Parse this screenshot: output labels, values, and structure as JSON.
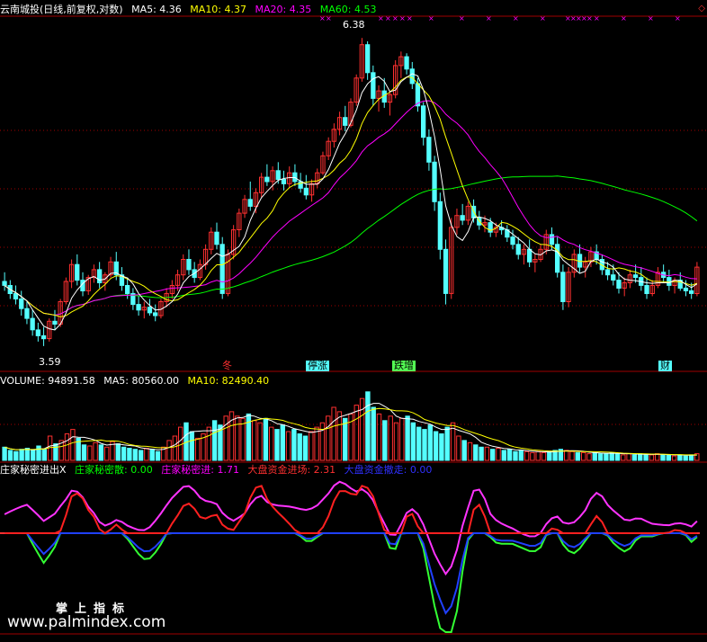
{
  "header": {
    "title": "云南城投(日线,前复权,对数)",
    "ma5": "MA5: 4.36",
    "ma10": "MA10: 4.37",
    "ma20": "MA20: 4.35",
    "ma60": "MA60: 4.53"
  },
  "volume_header": {
    "volume": "VOLUME: 94891.58",
    "ma5": "MA5: 80560.00",
    "ma10": "MA10: 82490.40"
  },
  "indicator_header": {
    "name": "庄家秘密进出X",
    "l1": "庄家秘密散: 0.00",
    "l2": "庄家秘密进: 1.71",
    "l3": "大盘资金进场: 2.31",
    "l4": "大盘资金撤走: 0.00"
  },
  "annotations": {
    "high": "6.38",
    "low": "3.59",
    "tag1": "停涨",
    "tag2": "跌增",
    "tag3": "财",
    "tag0": "冬"
  },
  "watermark": {
    "line1": "掌上指标",
    "line2": "www.palmindex.com"
  },
  "colors": {
    "up": "#ff3030",
    "down": "#54ffff",
    "ma5": "#ffffff",
    "ma10": "#ffff00",
    "ma20": "#ff00ff",
    "ma60": "#00ff00",
    "grid": "#a00000"
  },
  "chart_data": {
    "type": "candlestick",
    "price_scale": "log",
    "ylim": [
      3.5,
      6.6
    ],
    "ohlc": [
      [
        4.05,
        4.12,
        3.98,
        4.02
      ],
      [
        4.02,
        4.06,
        3.92,
        3.96
      ],
      [
        3.96,
        4.02,
        3.88,
        3.92
      ],
      [
        3.92,
        3.98,
        3.8,
        3.85
      ],
      [
        3.85,
        3.9,
        3.74,
        3.78
      ],
      [
        3.78,
        3.84,
        3.66,
        3.7
      ],
      [
        3.7,
        3.75,
        3.62,
        3.66
      ],
      [
        3.66,
        3.72,
        3.59,
        3.64
      ],
      [
        3.64,
        3.78,
        3.62,
        3.76
      ],
      [
        3.76,
        3.84,
        3.7,
        3.74
      ],
      [
        3.74,
        3.92,
        3.72,
        3.9
      ],
      [
        3.9,
        4.08,
        3.88,
        4.05
      ],
      [
        4.05,
        4.22,
        4.0,
        4.18
      ],
      [
        4.18,
        4.26,
        4.02,
        4.06
      ],
      [
        4.06,
        4.12,
        3.94,
        3.98
      ],
      [
        3.98,
        4.1,
        3.95,
        4.08
      ],
      [
        4.08,
        4.18,
        4.04,
        4.14
      ],
      [
        4.14,
        4.2,
        4.0,
        4.04
      ],
      [
        4.04,
        4.12,
        3.98,
        4.1
      ],
      [
        4.1,
        4.24,
        4.08,
        4.2
      ],
      [
        4.2,
        4.28,
        4.06,
        4.1
      ],
      [
        4.1,
        4.16,
        3.98,
        4.02
      ],
      [
        4.02,
        4.08,
        3.92,
        3.96
      ],
      [
        3.96,
        4.0,
        3.84,
        3.88
      ],
      [
        3.88,
        3.94,
        3.8,
        3.84
      ],
      [
        3.84,
        3.9,
        3.78,
        3.86
      ],
      [
        3.86,
        3.92,
        3.8,
        3.82
      ],
      [
        3.82,
        3.88,
        3.76,
        3.8
      ],
      [
        3.8,
        3.92,
        3.78,
        3.9
      ],
      [
        3.9,
        4.0,
        3.86,
        3.96
      ],
      [
        3.96,
        4.06,
        3.92,
        4.02
      ],
      [
        4.02,
        4.14,
        3.98,
        4.1
      ],
      [
        4.1,
        4.26,
        4.06,
        4.22
      ],
      [
        4.22,
        4.3,
        4.1,
        4.14
      ],
      [
        4.14,
        4.2,
        4.04,
        4.08
      ],
      [
        4.08,
        4.22,
        4.06,
        4.18
      ],
      [
        4.18,
        4.34,
        4.14,
        4.3
      ],
      [
        4.3,
        4.48,
        4.26,
        4.44
      ],
      [
        4.44,
        4.52,
        4.3,
        4.34
      ],
      [
        4.34,
        4.4,
        3.92,
        3.96
      ],
      [
        3.96,
        4.3,
        3.94,
        4.26
      ],
      [
        4.26,
        4.5,
        4.22,
        4.46
      ],
      [
        4.46,
        4.64,
        4.4,
        4.6
      ],
      [
        4.6,
        4.76,
        4.56,
        4.72
      ],
      [
        4.72,
        4.88,
        4.62,
        4.66
      ],
      [
        4.66,
        4.82,
        4.6,
        4.78
      ],
      [
        4.78,
        4.96,
        4.74,
        4.92
      ],
      [
        4.92,
        5.04,
        4.84,
        4.88
      ],
      [
        4.88,
        5.02,
        4.8,
        4.98
      ],
      [
        4.98,
        5.06,
        4.86,
        4.9
      ],
      [
        4.9,
        4.98,
        4.8,
        4.86
      ],
      [
        4.86,
        5.02,
        4.82,
        4.96
      ],
      [
        4.96,
        5.04,
        4.84,
        4.88
      ],
      [
        4.88,
        4.96,
        4.78,
        4.82
      ],
      [
        4.82,
        4.94,
        4.72,
        4.76
      ],
      [
        4.76,
        4.9,
        4.7,
        4.86
      ],
      [
        4.86,
        5.0,
        4.82,
        4.96
      ],
      [
        4.96,
        5.16,
        4.94,
        5.12
      ],
      [
        5.12,
        5.3,
        5.08,
        5.26
      ],
      [
        5.26,
        5.44,
        5.2,
        5.38
      ],
      [
        5.38,
        5.56,
        5.32,
        5.5
      ],
      [
        5.5,
        5.62,
        5.36,
        5.42
      ],
      [
        5.42,
        5.7,
        5.4,
        5.66
      ],
      [
        5.66,
        5.96,
        5.62,
        5.92
      ],
      [
        5.92,
        6.38,
        5.88,
        6.3
      ],
      [
        6.3,
        6.34,
        5.9,
        5.98
      ],
      [
        5.98,
        6.06,
        5.62,
        5.7
      ],
      [
        5.7,
        5.84,
        5.56,
        5.78
      ],
      [
        5.78,
        5.92,
        5.6,
        5.66
      ],
      [
        5.66,
        5.78,
        5.52,
        5.74
      ],
      [
        5.74,
        6.12,
        5.7,
        6.06
      ],
      [
        6.06,
        6.22,
        5.92,
        6.16
      ],
      [
        6.16,
        6.2,
        5.96,
        6.02
      ],
      [
        6.02,
        6.1,
        5.8,
        5.86
      ],
      [
        5.86,
        5.92,
        5.56,
        5.62
      ],
      [
        5.62,
        5.66,
        5.22,
        5.3
      ],
      [
        5.3,
        5.38,
        4.98,
        5.06
      ],
      [
        5.06,
        5.12,
        4.62,
        4.7
      ],
      [
        4.7,
        4.78,
        4.22,
        4.3
      ],
      [
        4.3,
        4.38,
        3.88,
        3.96
      ],
      [
        3.96,
        4.56,
        3.92,
        4.48
      ],
      [
        4.48,
        4.64,
        4.42,
        4.58
      ],
      [
        4.58,
        4.68,
        4.5,
        4.54
      ],
      [
        4.54,
        4.7,
        4.5,
        4.66
      ],
      [
        4.66,
        4.72,
        4.52,
        4.56
      ],
      [
        4.56,
        4.62,
        4.46,
        4.5
      ],
      [
        4.5,
        4.58,
        4.44,
        4.52
      ],
      [
        4.52,
        4.56,
        4.4,
        4.44
      ],
      [
        4.44,
        4.52,
        4.4,
        4.48
      ],
      [
        4.48,
        4.54,
        4.42,
        4.46
      ],
      [
        4.46,
        4.5,
        4.36,
        4.4
      ],
      [
        4.4,
        4.46,
        4.3,
        4.34
      ],
      [
        4.34,
        4.4,
        4.22,
        4.26
      ],
      [
        4.26,
        4.34,
        4.18,
        4.3
      ],
      [
        4.3,
        4.38,
        4.16,
        4.2
      ],
      [
        4.2,
        4.26,
        4.12,
        4.22
      ],
      [
        4.22,
        4.34,
        4.2,
        4.3
      ],
      [
        4.3,
        4.46,
        4.26,
        4.42
      ],
      [
        4.42,
        4.48,
        4.3,
        4.34
      ],
      [
        4.34,
        4.4,
        4.08,
        4.12
      ],
      [
        4.12,
        4.18,
        3.84,
        3.9
      ],
      [
        3.9,
        4.16,
        3.86,
        4.12
      ],
      [
        4.12,
        4.3,
        4.08,
        4.26
      ],
      [
        4.26,
        4.34,
        4.12,
        4.16
      ],
      [
        4.16,
        4.24,
        4.08,
        4.2
      ],
      [
        4.2,
        4.32,
        4.16,
        4.28
      ],
      [
        4.28,
        4.34,
        4.18,
        4.22
      ],
      [
        4.22,
        4.26,
        4.1,
        4.14
      ],
      [
        4.14,
        4.2,
        4.06,
        4.1
      ],
      [
        4.1,
        4.18,
        4.02,
        4.06
      ],
      [
        4.06,
        4.12,
        3.96,
        4.0
      ],
      [
        4.0,
        4.08,
        3.94,
        4.04
      ],
      [
        4.04,
        4.14,
        4.0,
        4.1
      ],
      [
        4.1,
        4.18,
        4.04,
        4.08
      ],
      [
        4.08,
        4.16,
        3.98,
        4.02
      ],
      [
        4.02,
        4.08,
        3.92,
        3.96
      ],
      [
        3.96,
        4.06,
        3.94,
        4.02
      ],
      [
        4.02,
        4.16,
        4.0,
        4.12
      ],
      [
        4.12,
        4.18,
        4.04,
        4.08
      ],
      [
        4.08,
        4.14,
        3.98,
        4.02
      ],
      [
        4.02,
        4.08,
        3.96,
        4.06
      ],
      [
        4.06,
        4.12,
        3.98,
        4.0
      ],
      [
        4.0,
        4.06,
        3.94,
        3.98
      ],
      [
        3.98,
        4.04,
        3.92,
        3.96
      ],
      [
        3.96,
        4.2,
        3.94,
        4.16
      ]
    ],
    "volume": [
      12,
      9,
      8,
      10,
      11,
      9,
      13,
      10,
      22,
      15,
      18,
      24,
      28,
      20,
      14,
      13,
      16,
      14,
      12,
      17,
      15,
      12,
      11,
      10,
      9,
      11,
      10,
      8,
      12,
      18,
      22,
      30,
      34,
      26,
      20,
      24,
      30,
      36,
      32,
      40,
      44,
      40,
      38,
      42,
      36,
      34,
      38,
      30,
      28,
      32,
      26,
      28,
      24,
      22,
      26,
      30,
      34,
      40,
      48,
      44,
      38,
      42,
      50,
      56,
      62,
      48,
      42,
      36,
      40,
      34,
      38,
      40,
      34,
      30,
      28,
      32,
      26,
      24,
      30,
      34,
      22,
      18,
      16,
      14,
      12,
      12,
      10,
      11,
      9,
      10,
      8,
      9,
      8,
      7,
      8,
      7,
      8,
      9,
      10,
      9,
      8,
      7,
      7,
      6,
      7,
      6,
      6,
      7,
      6,
      5,
      6,
      5,
      6,
      5,
      5,
      6,
      5,
      5,
      4,
      5,
      4,
      5,
      6
    ],
    "indicators": [
      {
        "name": "庄家秘密散",
        "value": 0.0
      },
      {
        "name": "庄家秘密进",
        "value": 1.71
      },
      {
        "name": "大盘资金进场",
        "value": 2.31
      },
      {
        "name": "大盘资金撤走",
        "value": 0.0
      }
    ],
    "ma": {
      "ma5": 4.36,
      "ma10": 4.37,
      "ma20": 4.35,
      "ma60": 4.53
    },
    "volume_ma": {
      "volume": 94891.58,
      "ma5": 80560.0,
      "ma10": 82490.4
    },
    "extremes": {
      "high": 6.38,
      "low": 3.59
    }
  }
}
